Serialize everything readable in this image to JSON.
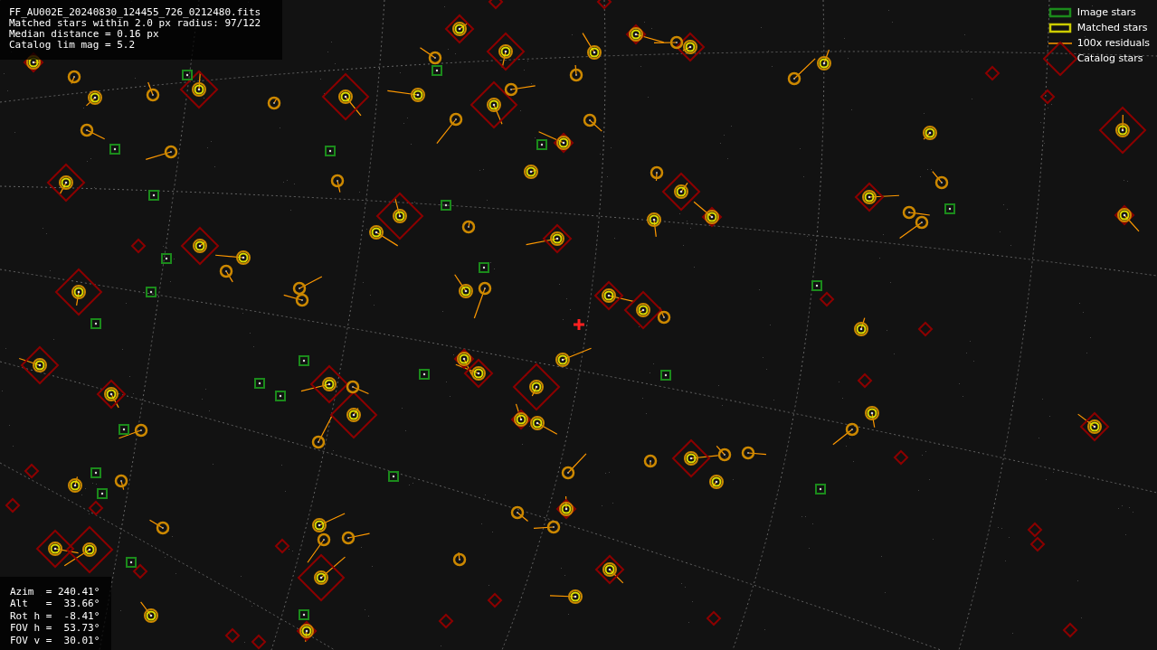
{
  "info_panel": {
    "lines": [
      "FF_AU002E_20240830_124455_726_0212480.fits",
      "Matched stars within 2.0 px radius: 97/122",
      "Median distance = 0.16 px",
      "Catalog lim mag = 5.2"
    ]
  },
  "legend": [
    {
      "kind": "image",
      "label": "Image stars"
    },
    {
      "kind": "matched",
      "label": "Matched stars"
    },
    {
      "kind": "residual",
      "label": "100x residuals"
    },
    {
      "kind": "catalog",
      "label": "Catalog stars"
    }
  ],
  "pointing_panel": {
    "lines": [
      "Azim  = 240.41°",
      "Alt   =  33.66°",
      "Rot h =  -8.41°",
      "FOV h =  53.73°",
      "FOV v =  30.01°"
    ]
  }
}
